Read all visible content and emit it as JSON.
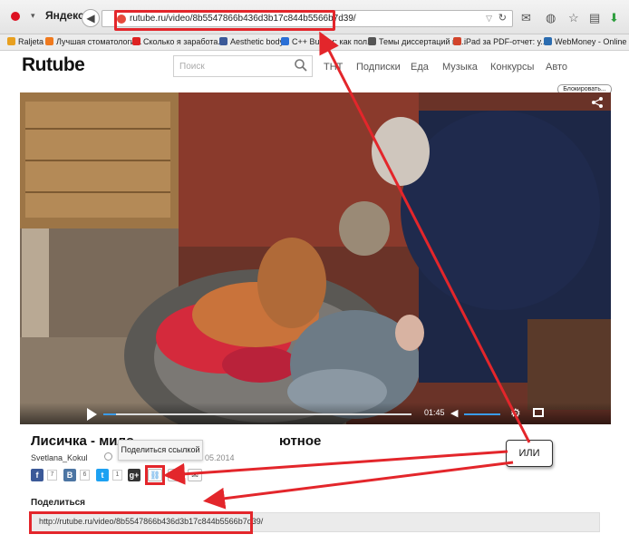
{
  "browser": {
    "brand": "Яндекс",
    "url": "rutube.ru/video/8b5547866b436d3b17c844b5566b7d39/",
    "bookmarks": [
      {
        "label": "Raljeta",
        "color": "#e8a020"
      },
      {
        "label": "Лучшая стоматологи...",
        "color": "#f07a1e"
      },
      {
        "label": "Сколько я заработа...",
        "color": "#d22"
      },
      {
        "label": "Aesthetic body",
        "color": "#3b5998"
      },
      {
        "label": "C++ Builder: как пол...",
        "color": "#2a6fd6"
      },
      {
        "label": "Темы диссертаций и ...",
        "color": "#555"
      },
      {
        "label": "iPad за PDF-отчет: у...",
        "color": "#d2442b"
      },
      {
        "label": "WebMoney - Online P...",
        "color": "#2b6cb0"
      }
    ]
  },
  "site": {
    "logo": "Rutube",
    "search_placeholder": "Поиск",
    "nav": [
      "ТНТ",
      "Подписки",
      "Еда",
      "Музыка",
      "Конкурсы",
      "Авто"
    ],
    "block_label": "Блокировать..."
  },
  "player": {
    "time": "01:45",
    "progress": 0.04,
    "volume": 1.0
  },
  "video": {
    "title": "Лисичка - мило",
    "title_tail": "ютное",
    "author": "Svetlana_Kokul",
    "date": "05.2014"
  },
  "share": {
    "tooltip": "Поделиться ссылкой",
    "counts": {
      "facebook": "7",
      "vk": "6",
      "twitter": "1"
    },
    "section_title": "Поделиться",
    "link": "http://rutube.ru/video/8b5547866b436d3b17c844b5566b7d39/"
  },
  "annotation": {
    "label": "ИЛИ"
  },
  "colors": {
    "highlight": "#e3262b",
    "progress": "#3a9be8",
    "facebook": "#3b5998",
    "vk": "#4c75a3",
    "twitter": "#1da1f2",
    "gplus": "#333333"
  }
}
